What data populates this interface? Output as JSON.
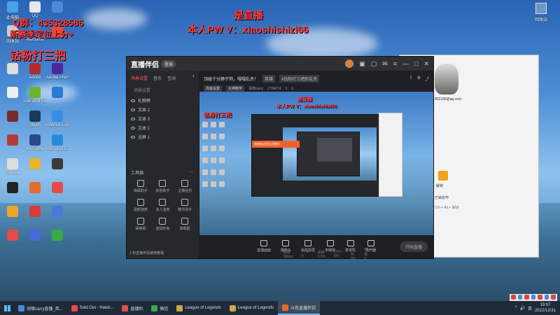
{
  "overlay": {
    "qq_group": "Q群：435328586",
    "season_line": "新赛季定位上分+",
    "live_tag": "是直播",
    "contact": "本人PW V：xiaoshishizi66",
    "promo": "钻粉打三把"
  },
  "desktop": {
    "icons": [
      {
        "label": "此电脑",
        "color": "#4aa3e8"
      },
      {
        "label": "QQ",
        "color": "#e8e8e8"
      },
      {
        "label": "",
        "color": "#4a8ad8"
      },
      {
        "label": "回收站",
        "color": "#cccccc"
      },
      {
        "label": "WeGame",
        "color": "#2b7de0"
      },
      {
        "label": "",
        "color": "#e84a3a"
      },
      {
        "label": "",
        "color": "#dddddd"
      },
      {
        "label": "Adobe",
        "color": "#b42a2a"
      },
      {
        "label": "Adobe Premiere",
        "color": "#4a2a9a"
      },
      {
        "label": "",
        "color": "#eeeeee"
      },
      {
        "label": "GeForce Experience",
        "color": "#6ab42a"
      },
      {
        "label": "",
        "color": "#2a7ad8"
      },
      {
        "label": "",
        "color": "#7a2a2a"
      },
      {
        "label": "Steam",
        "color": "#1a3a5a"
      },
      {
        "label": "Internet Explorer",
        "color": "#3a8ae8"
      },
      {
        "label": "",
        "color": "#b43a3a"
      },
      {
        "label": "WeGame",
        "color": "#2a4a8a"
      },
      {
        "label": "Microsoft Edge",
        "color": "#2a8ad8"
      },
      {
        "label": "Garena",
        "color": "#dddddd"
      },
      {
        "label": "",
        "color": "#e8b42a"
      },
      {
        "label": "",
        "color": "#3a3a3a"
      },
      {
        "label": "",
        "color": "#222222"
      },
      {
        "label": "",
        "color": "#e86a2a"
      },
      {
        "label": "",
        "color": "#e84a4a"
      },
      {
        "label": "",
        "color": "#e8a82a"
      },
      {
        "label": "",
        "color": "#d83a3a"
      },
      {
        "label": "",
        "color": "#4a7ad8"
      },
      {
        "label": "",
        "color": "#e84a4a"
      },
      {
        "label": "",
        "color": "#4a6ad8"
      },
      {
        "label": "",
        "color": "#3aa84a"
      }
    ],
    "recycle_bin": "回收站"
  },
  "app": {
    "title": "直播伴侣",
    "badge": "登录",
    "left_tabs": [
      "场景设置",
      "音乐",
      "互动"
    ],
    "scene_header": "场景设置",
    "sources": [
      "礼物榜",
      "文本 2",
      "文本 3",
      "文本 1",
      "全屏 1"
    ],
    "tools_title": "工具箱",
    "tools": [
      "弹幕助手",
      "房管助手",
      "主播任务",
      "视频连麦",
      "多人连麦",
      "精华助手",
      "弹弹幕",
      "虚拟形象",
      "弹幕图"
    ],
    "bottom_status": "1.色直播伴侣使用教程",
    "stream_title": "顶级千分狮子狗，嘎嘎乱杀！",
    "category_tag": "英雄",
    "edit_tag": "#钻粉打三把的乱杀",
    "meta_tag1": "高级设置",
    "meta_tag2": "大神教学",
    "meta_user": "润德carry",
    "meta_id": "1784274",
    "meta_count1": "0",
    "meta_count2": "0",
    "preview_text1": "是直播",
    "preview_text2": "本人PW V：xiaoshishizi66",
    "preview_text3": "钻粉打三把",
    "orange_banner": "快来加点关注点赞呀~",
    "controls": [
      "直播画面",
      "摄像头",
      "手机投屏",
      "多媒体",
      "麦克风",
      "扬声器"
    ],
    "start_button": "开始直播",
    "status": [
      "码率 0kbps",
      "FPS: 0",
      "丢帧 0.0%",
      "CPU: 9%",
      "内存 0%",
      "帧率 0"
    ]
  },
  "chat": {
    "email": "852188@qq.com",
    "t1": "解锁",
    "t2": "已锁定中",
    "t3": "Ctrl + Alt + 解锁"
  },
  "taskbar": {
    "items": [
      {
        "label": "润德carry直播_英...",
        "color": "#4a8ad8",
        "active": false
      },
      {
        "label": "Sold Out - Hawk...",
        "color": "#e84a4a",
        "active": false
      },
      {
        "label": "直播机",
        "color": "#e84a4a",
        "active": false
      },
      {
        "label": "微信",
        "color": "#3aa84a",
        "active": false
      },
      {
        "label": "League of Legends",
        "color": "#c9a84a",
        "active": false
      },
      {
        "label": "League of Legends",
        "color": "#c9a84a",
        "active": false
      },
      {
        "label": "斗色直播伴侣",
        "color": "#e8682a",
        "active": true
      }
    ],
    "time": "19:07",
    "date": "2022/12/31",
    "ime": "英"
  }
}
